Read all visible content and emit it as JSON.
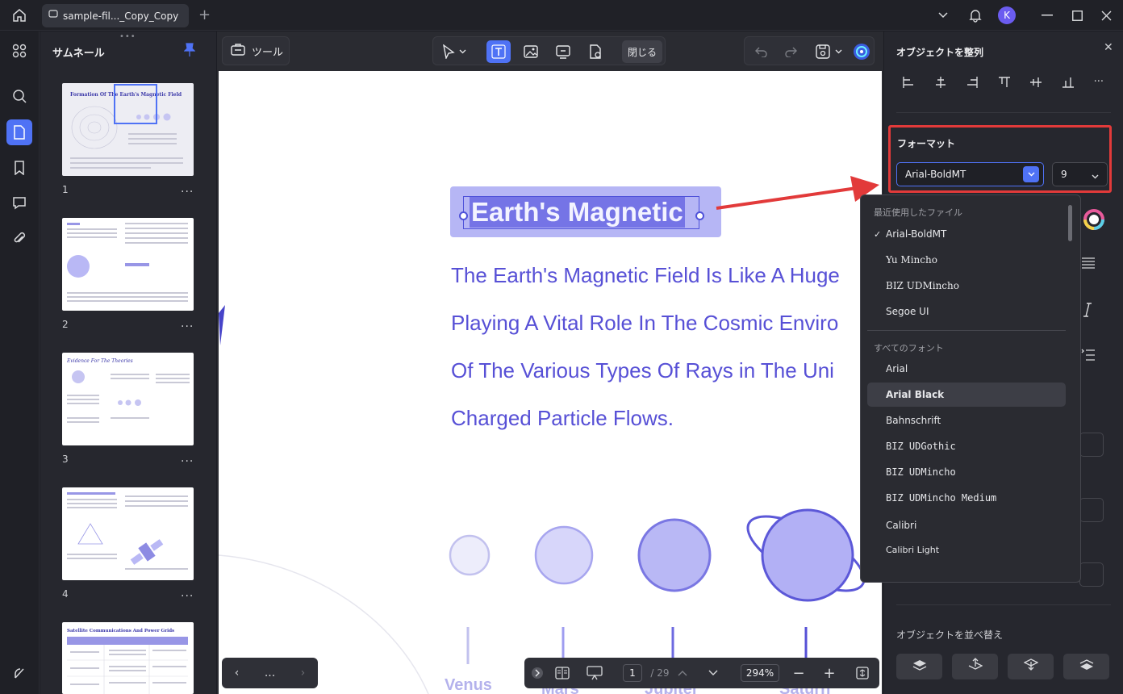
{
  "titlebar": {
    "tab_title": "sample-fil..._Copy_Copy",
    "avatar_letter": "K"
  },
  "thumbnail_panel": {
    "title": "サムネール",
    "pages": [
      {
        "number": "1",
        "heading": "Formation Of The Earth's Magnetic Field"
      },
      {
        "number": "2",
        "heading": ""
      },
      {
        "number": "3",
        "heading": "Evidence For The Theories"
      },
      {
        "number": "4",
        "heading": ""
      },
      {
        "number": "",
        "heading": "Satellite Communications And Power Grids"
      }
    ],
    "more_label": "..."
  },
  "toolbar": {
    "tools_label": "ツール",
    "close_label": "閉じる"
  },
  "document": {
    "title_text": "Earth's Magnetic",
    "body_lines": [
      "The Earth's Magnetic Field Is Like A Huge",
      "Playing A Vital Role In The Cosmic Enviro",
      "Of The Various Types Of Rays in The Uni",
      "Charged Particle Flows."
    ],
    "planet_labels": [
      "Venus",
      "Mars",
      "Jupiter",
      "Saturn"
    ]
  },
  "navigation": {
    "more": "...",
    "current_page": "1",
    "total_pages": "/ 29",
    "zoom": "294%"
  },
  "right_panel": {
    "align_title": "オブジェクトを整列",
    "format_title": "フォーマット",
    "font_value": "Arial-BoldMT",
    "size_value": "9",
    "order_title": "オブジェクトを並べ替え"
  },
  "font_dropdown": {
    "recent_label": "最近使用したファイル",
    "recent_fonts": [
      "Arial-BoldMT",
      "Yu Mincho",
      "BIZ UDMincho",
      "Segoe UI"
    ],
    "all_label": "すべてのフォント",
    "all_fonts": [
      "Arial",
      "Arial Black",
      "Bahnschrift",
      "BIZ UDGothic",
      "BIZ UDMincho",
      "BIZ UDMincho Medium",
      "Calibri",
      "Calibri Light"
    ],
    "checked": "Arial-BoldMT",
    "hovered": "Arial Black"
  },
  "colors": {
    "accent": "#4f72f5",
    "highlight_border": "#e23a3a",
    "doc_text": "#5750d6",
    "planet_fill": "#b9b8f5"
  }
}
